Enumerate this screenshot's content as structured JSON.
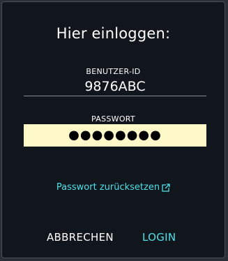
{
  "dialog": {
    "title": "Hier einloggen:",
    "user_label": "BENUTZER-ID",
    "user_value": "9876ABC",
    "password_label": "PASSWORT",
    "password_value": "●●●●●●●●",
    "reset_link": "Passwort zurücksetzen",
    "cancel_label": "ABBRECHEN",
    "login_label": "LOGIN"
  },
  "colors": {
    "accent": "#4fe0e8",
    "dialog_bg": "#11161d",
    "password_bg": "#fff8c9"
  },
  "icons": {
    "reset_link_icon": "external-link-icon"
  }
}
